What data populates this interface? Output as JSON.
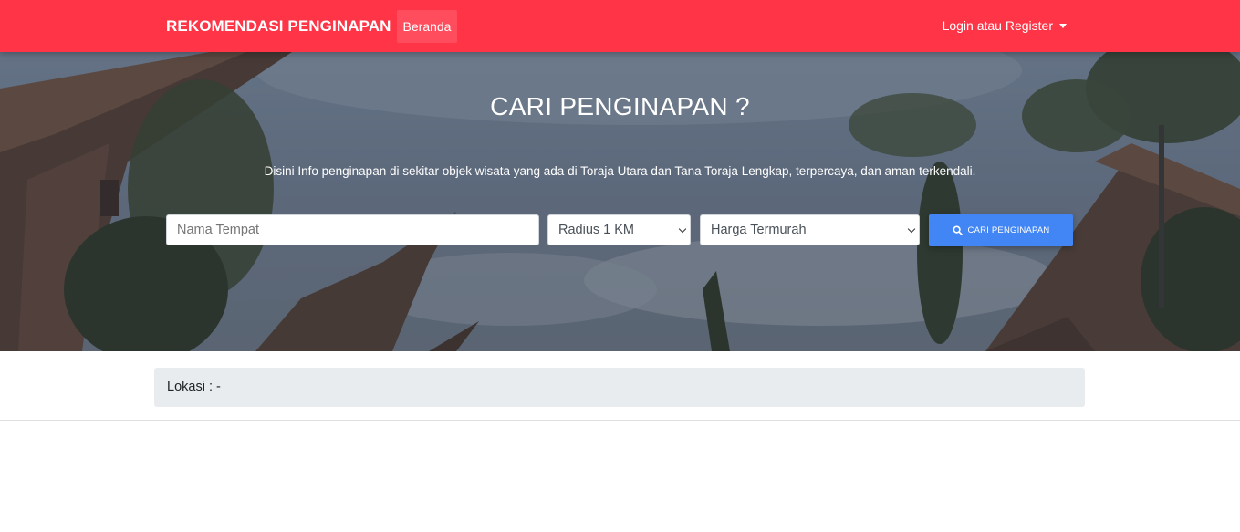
{
  "navbar": {
    "brand": "REKOMENDASI PENGINAPAN",
    "home_label": "Beranda",
    "login_label": "Login atau Register",
    "color": "#ff3547"
  },
  "hero": {
    "title": "CARI PENGINAPAN ?",
    "subtitle": "Disini Info penginapan di sekitar objek wisata yang ada di Toraja Utara dan Tana Toraja Lengkap, terpercaya, dan aman terkendali."
  },
  "search": {
    "name_placeholder": "Nama Tempat",
    "radius_selected": "Radius 1 KM",
    "price_selected": "Harga Termurah",
    "button_label": "CARI PENGINAPAN",
    "button_color": "#4285f4",
    "icons": {
      "button": "search-icon",
      "select": "chevron-down-icon",
      "login": "caret-down-icon"
    }
  },
  "location": {
    "label": "Lokasi : -"
  }
}
